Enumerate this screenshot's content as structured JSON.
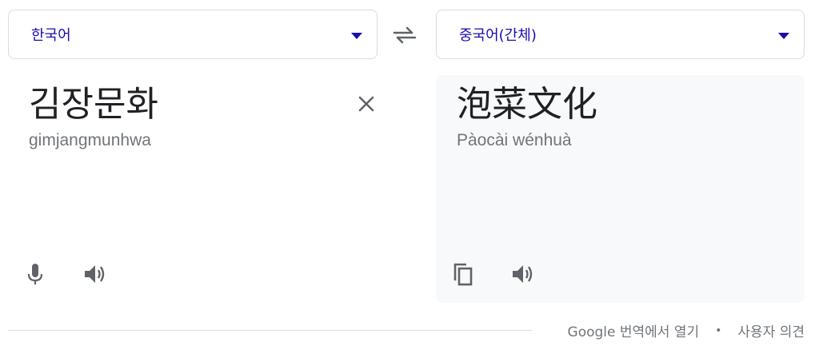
{
  "source": {
    "language": "한국어",
    "text": "김장문화",
    "romanization": "gimjangmunhwa"
  },
  "target": {
    "language": "중국어(간체)",
    "text": "泡菜文化",
    "romanization": "Pàocài wénhuà"
  },
  "icons": {
    "swap": "swap-languages-icon",
    "clear": "close-icon",
    "mic": "microphone-icon",
    "speaker": "speaker-icon",
    "copy": "copy-icon"
  },
  "footer": {
    "open_link": "Google 번역에서 열기",
    "separator": "•",
    "feedback_link": "사용자 의견"
  },
  "colors": {
    "accent": "#1a0dab",
    "text": "#202124",
    "secondary_text": "#70757a",
    "icon": "#5f6368",
    "target_background": "#f8f9fa"
  }
}
